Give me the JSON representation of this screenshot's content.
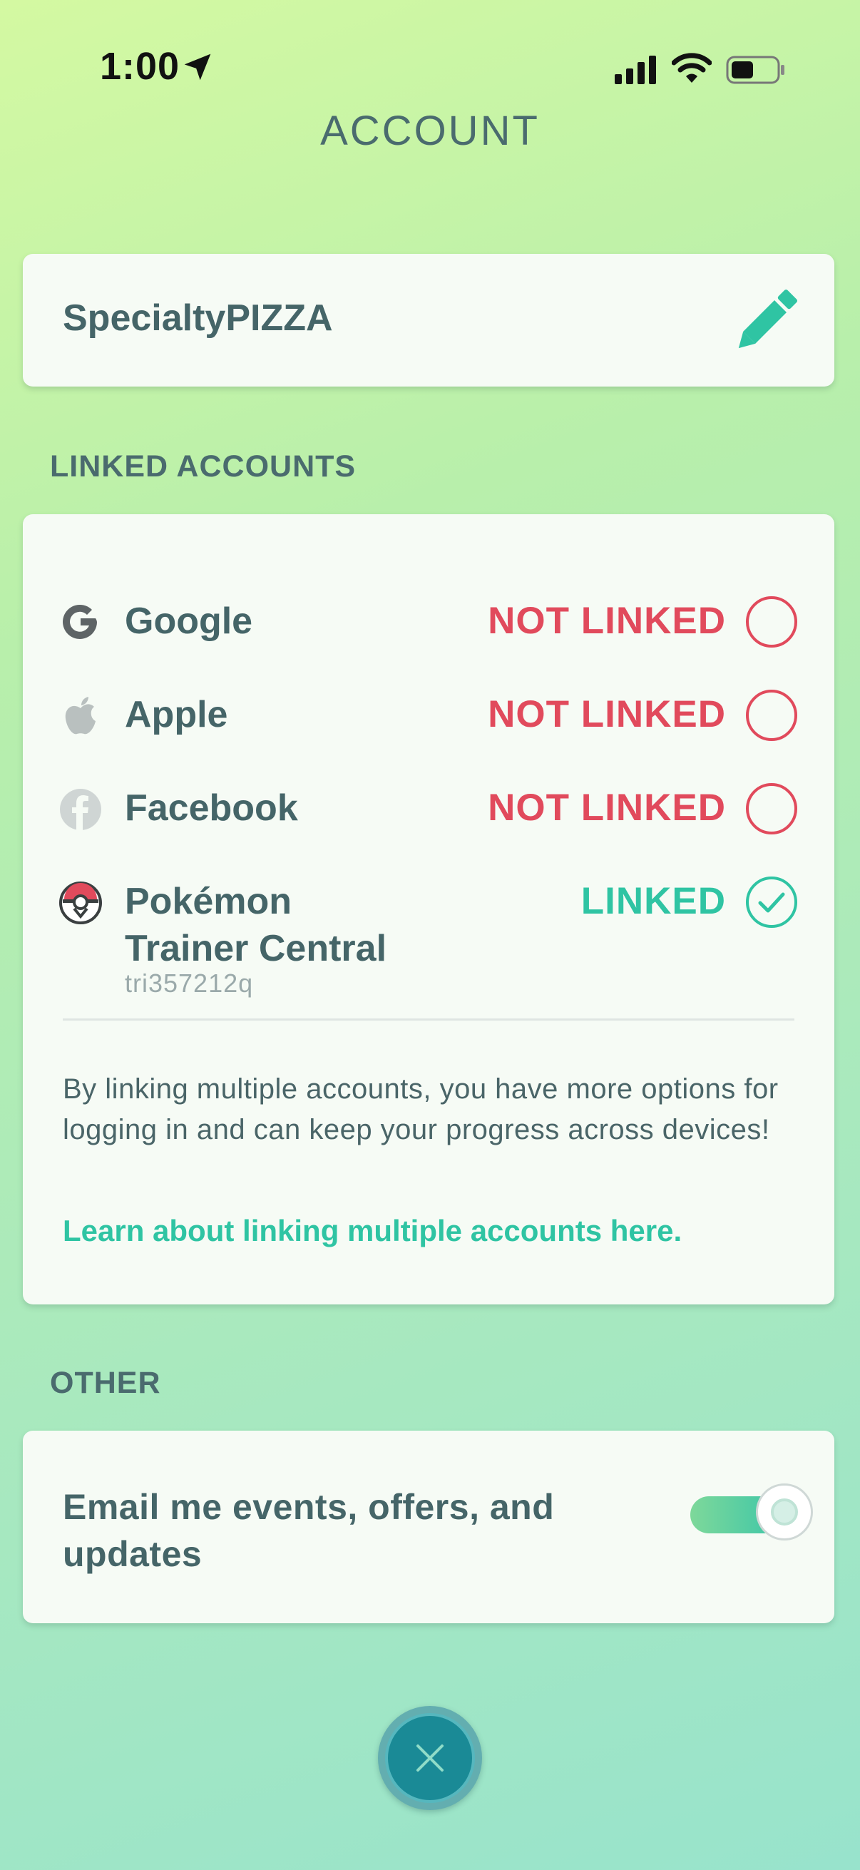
{
  "status_bar": {
    "time": "1:00"
  },
  "header": {
    "title": "ACCOUNT"
  },
  "profile": {
    "username": "SpecialtyPIZZA"
  },
  "linked_accounts": {
    "label": "LINKED ACCOUNTS",
    "items": [
      {
        "name": "Google",
        "status": "NOT LINKED",
        "icon": "google-icon"
      },
      {
        "name": "Apple",
        "status": "NOT LINKED",
        "icon": "apple-icon"
      },
      {
        "name": "Facebook",
        "status": "NOT LINKED",
        "icon": "facebook-icon"
      },
      {
        "name_line1": "Pokémon",
        "name_line2": "Trainer Central",
        "status": "LINKED",
        "sub": "tri357212q",
        "icon": "pokeball-icon"
      }
    ],
    "info": "By linking multiple accounts, you have more options for logging in and can keep your progress across devices!",
    "learn_link": "Learn about linking multiple accounts here."
  },
  "other": {
    "label": "OTHER",
    "email_label": "Email me events, offers, and updates",
    "email_toggle_on": true
  },
  "colors": {
    "accent": "#2fc4a3",
    "danger": "#e14a5c",
    "text": "#456568"
  }
}
